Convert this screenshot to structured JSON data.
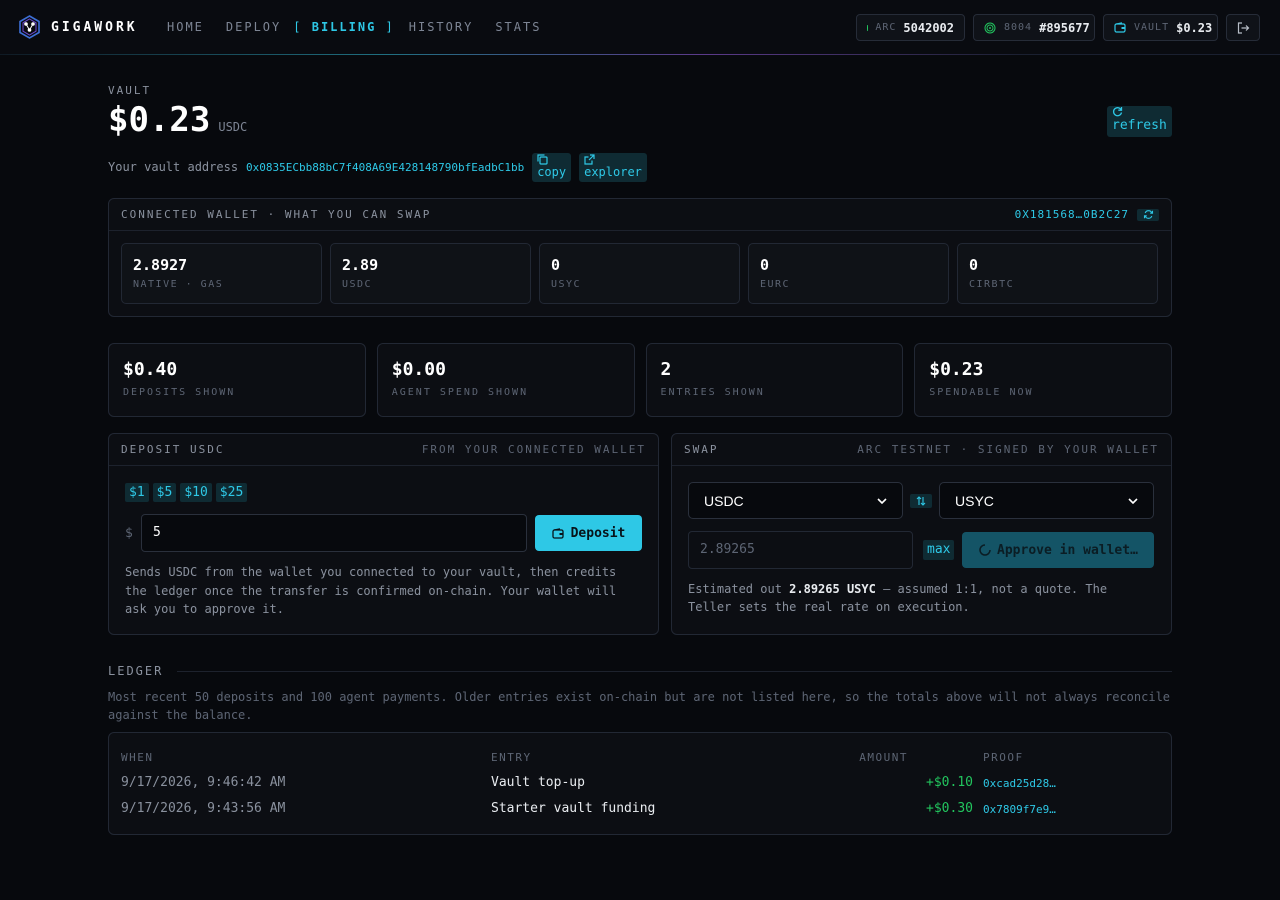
{
  "nav": {
    "brand": "GIGAWORK",
    "links": [
      "HOME",
      "DEPLOY",
      "BILLING",
      "HISTORY",
      "STATS"
    ],
    "active": "BILLING",
    "pills": {
      "arc_label": "ARC",
      "arc_value": "5042002",
      "id_label": "8004",
      "id_value": "#895677",
      "vault_label": "VAULT",
      "vault_value": "$0.23"
    }
  },
  "vault": {
    "label": "VAULT",
    "amount": "$0.23",
    "unit": "USDC",
    "refresh_label": "refresh",
    "address_lead": "Your vault address",
    "address": "0x0835ECbb88bC7f408A69E428148790bfEadbC1bb",
    "copy_label": "copy",
    "explorer_label": "explorer"
  },
  "wallet": {
    "title": "CONNECTED WALLET · WHAT YOU CAN SWAP",
    "address": "0X181568…0B2C27",
    "tokens": [
      {
        "value": "2.8927",
        "label": "NATIVE · GAS"
      },
      {
        "value": "2.89",
        "label": "USDC"
      },
      {
        "value": "0",
        "label": "USYC"
      },
      {
        "value": "0",
        "label": "EURC"
      },
      {
        "value": "0",
        "label": "CIRBTC"
      }
    ]
  },
  "stats": [
    {
      "value": "$0.40",
      "label": "DEPOSITS SHOWN"
    },
    {
      "value": "$0.00",
      "label": "AGENT SPEND SHOWN"
    },
    {
      "value": "2",
      "label": "ENTRIES SHOWN"
    },
    {
      "value": "$0.23",
      "label": "SPENDABLE NOW"
    }
  ],
  "deposit": {
    "title": "DEPOSIT USDC",
    "subtitle": "FROM YOUR CONNECTED WALLET",
    "chips": [
      "$1",
      "$5",
      "$10",
      "$25"
    ],
    "currency": "$",
    "amount": "5",
    "button": "Deposit",
    "note": "Sends USDC from the wallet you connected to your vault, then credits the ledger once the transfer is confirmed on-chain. Your wallet will ask you to approve it."
  },
  "swap": {
    "title": "SWAP",
    "subtitle": "ARC TESTNET · SIGNED BY YOUR WALLET",
    "from": "USDC",
    "to": "USYC",
    "amount_placeholder": "2.89265",
    "max_label": "max",
    "button": "Approve in wallet…",
    "note_prefix": "Estimated out",
    "note_value": "2.89265 USYC",
    "note_suffix": "— assumed 1:1, not a quote. The Teller sets the real rate on execution."
  },
  "ledger": {
    "title": "LEDGER",
    "note": "Most recent 50 deposits and 100 agent payments. Older entries exist on-chain but are not listed here, so the totals above will not always reconcile against the balance.",
    "columns": [
      "WHEN",
      "ENTRY",
      "AMOUNT",
      "PROOF"
    ],
    "rows": [
      {
        "when": "9/17/2026, 9:46:42 AM",
        "entry": "Vault top-up",
        "amount": "+$0.10",
        "proof": "0xcad25d28…"
      },
      {
        "when": "9/17/2026, 9:43:56 AM",
        "entry": "Starter vault funding",
        "amount": "+$0.30",
        "proof": "0x7809f7e9…"
      }
    ]
  },
  "colors": {
    "accent": "#2ec8e6",
    "positive": "#22c55e",
    "background": "#07090d"
  }
}
